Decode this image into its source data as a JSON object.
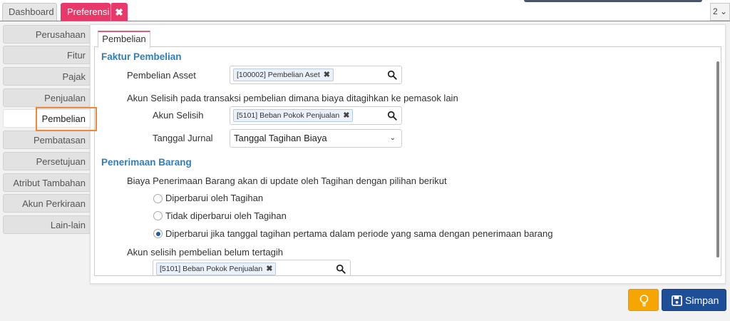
{
  "top_tabs": {
    "dashboard": "Dashboard",
    "preferensi": "Preferensi",
    "close": "✖",
    "pager": "2 ⌄"
  },
  "sidebar": {
    "items": [
      {
        "label": "Perusahaan"
      },
      {
        "label": "Fitur"
      },
      {
        "label": "Pajak"
      },
      {
        "label": "Penjualan"
      },
      {
        "label": "Pembelian"
      },
      {
        "label": "Pembatasan"
      },
      {
        "label": "Persetujuan"
      },
      {
        "label": "Atribut Tambahan"
      },
      {
        "label": "Akun Perkiraan"
      },
      {
        "label": "Lain-lain"
      }
    ],
    "active": "Pembelian"
  },
  "panel": {
    "tab": "Pembelian",
    "faktur": {
      "title": "Faktur Pembelian",
      "aset_label": "Pembelian Asset",
      "aset_value": "[100002] Pembelian Aset",
      "selisih_desc": "Akun Selisih pada transaksi pembelian dimana biaya ditagihkan ke pemasok lain",
      "akun_selisih_label": "Akun Selisih",
      "akun_selisih_value": "[5101] Beban Pokok Penjualan",
      "tanggal_label": "Tanggal Jurnal",
      "tanggal_value": "Tanggal Tagihan Biaya"
    },
    "penerimaan": {
      "title": "Penerimaan Barang",
      "desc": "Biaya Penerimaan Barang akan di update oleh Tagihan dengan pilihan berikut",
      "options": [
        {
          "label": "Diperbarui oleh Tagihan",
          "selected": false
        },
        {
          "label": "Tidak diperbarui oleh Tagihan",
          "selected": false
        },
        {
          "label": "Diperbarui jika tanggal tagihan pertama dalam periode yang sama dengan penerimaan barang",
          "selected": true
        }
      ],
      "belum_label": "Akun selisih pembelian belum tertagih",
      "belum_value": "[5101] Beban Pokok Penjualan"
    }
  },
  "buttons": {
    "save": "Simpan"
  },
  "colors": {
    "accent_pink": "#e8396a",
    "section_blue": "#2d7fc1",
    "save_blue": "#1f4e99",
    "bulb_orange": "#f7a600",
    "highlight_orange": "#f0883a"
  }
}
